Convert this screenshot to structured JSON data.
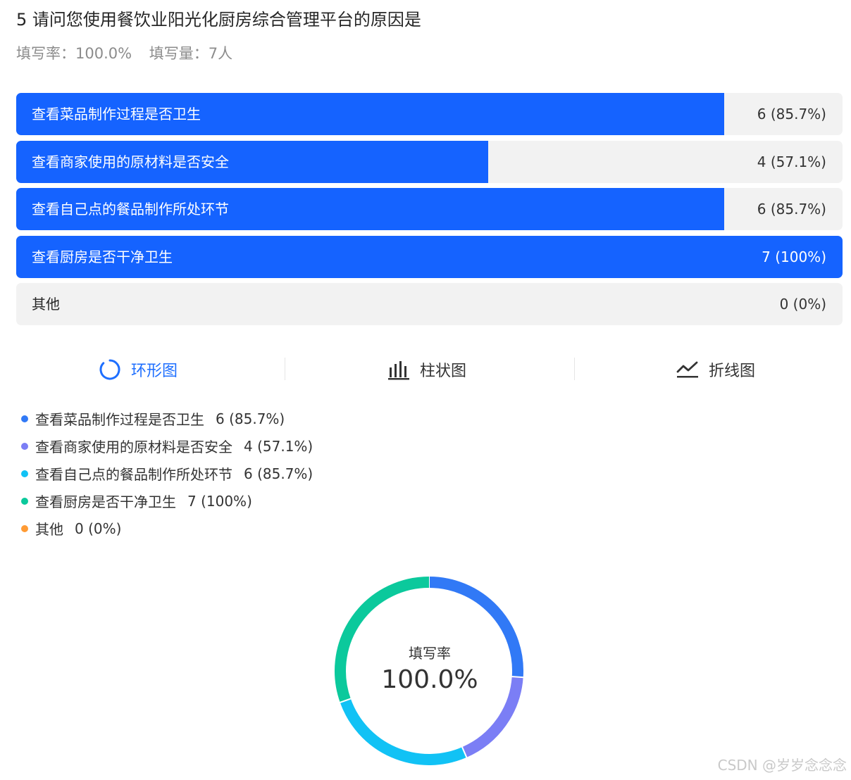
{
  "question": {
    "title": "5 请问您使用餐饮业阳光化厨房综合管理平台的原因是",
    "fill_rate": "填写率：100.0%",
    "fill_count": "填写量：7人"
  },
  "options": [
    {
      "label": "查看菜品制作过程是否卫生",
      "value_text": "6 (85.7%)",
      "ratio": 0.857,
      "legend_color": "#3179f6"
    },
    {
      "label": "查看商家使用的原材料是否安全",
      "value_text": "4 (57.1%)",
      "ratio": 0.571,
      "legend_color": "#7b7ef5"
    },
    {
      "label": "查看自己点的餐品制作所处环节",
      "value_text": "6 (85.7%)",
      "ratio": 0.857,
      "legend_color": "#11c2f5"
    },
    {
      "label": "查看厨房是否干净卫生",
      "value_text": "7 (100%)",
      "ratio": 1.0,
      "legend_color": "#0bc99c"
    },
    {
      "label": "其他",
      "value_text": "0 (0%)",
      "ratio": 0.0,
      "legend_color": "#ff9b34"
    }
  ],
  "tabs": [
    {
      "label": "环形图",
      "icon": "ring-icon",
      "active": true
    },
    {
      "label": "柱状图",
      "icon": "bar-chart-icon",
      "active": false
    },
    {
      "label": "折线图",
      "icon": "line-chart-icon",
      "active": false
    }
  ],
  "chart_data": {
    "type": "pie",
    "variant": "donut",
    "categories": [
      "查看菜品制作过程是否卫生",
      "查看商家使用的原材料是否安全",
      "查看自己点的餐品制作所处环节",
      "查看厨房是否干净卫生",
      "其他"
    ],
    "values": [
      6,
      4,
      6,
      7,
      0
    ],
    "colors": [
      "#3179f6",
      "#7b7ef5",
      "#11c2f5",
      "#0bc99c",
      "#ff9b34"
    ],
    "center_label": "填写率",
    "center_value": "100.0%"
  },
  "colors": {
    "bar_fill": "#1563ff",
    "bar_track": "#f2f2f2",
    "active_tab": "#1e6fff"
  },
  "watermark": "CSDN @岁岁念念念"
}
